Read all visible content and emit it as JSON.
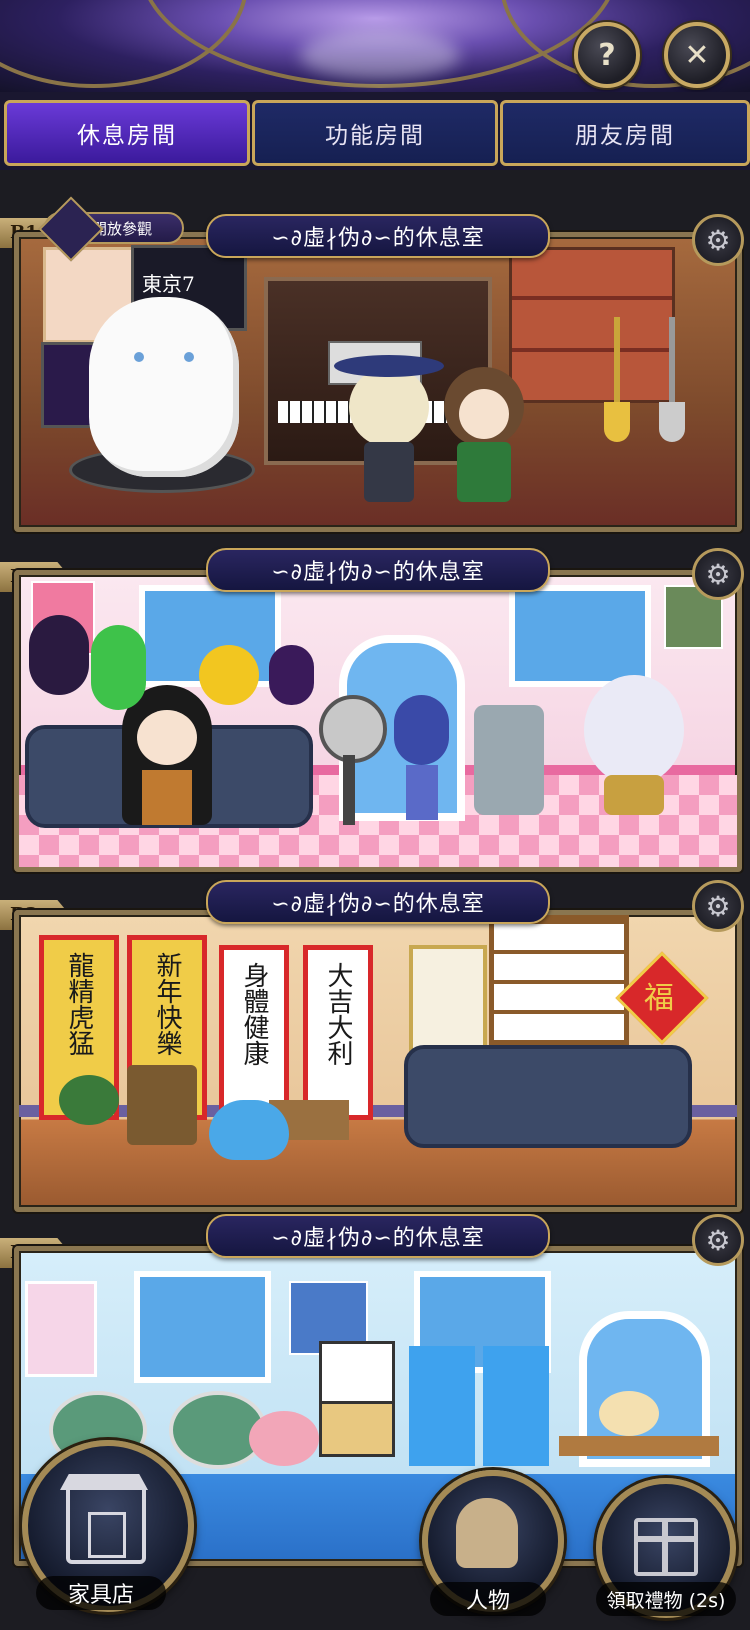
{
  "header": {
    "help_icon": "question-mark-icon",
    "close_icon": "close-x-icon"
  },
  "tabs": [
    {
      "label": "休息房間",
      "active": true
    },
    {
      "label": "功能房間",
      "active": false
    },
    {
      "label": "朋友房間",
      "active": false
    }
  ],
  "open_visit_label": "開放參觀",
  "rooms": [
    {
      "floor": "B1",
      "name": "∽∂虛∤伪∂∽的休息室"
    },
    {
      "floor": "B2",
      "name": "∽∂虛∤伪∂∽的休息室"
    },
    {
      "floor": "B3",
      "name": "∽∂虛∤伪∂∽的休息室"
    },
    {
      "floor": "B4",
      "name": "∽∂虛∤伪∂∽的休息室"
    }
  ],
  "banners": [
    "龍精虎猛",
    "新年快樂",
    "身體健康",
    "大吉大利"
  ],
  "fortune_sign": "福",
  "bottom": {
    "furniture_shop": "家具店",
    "characters": "人物",
    "claim_gift": "領取禮物 (2s)"
  }
}
